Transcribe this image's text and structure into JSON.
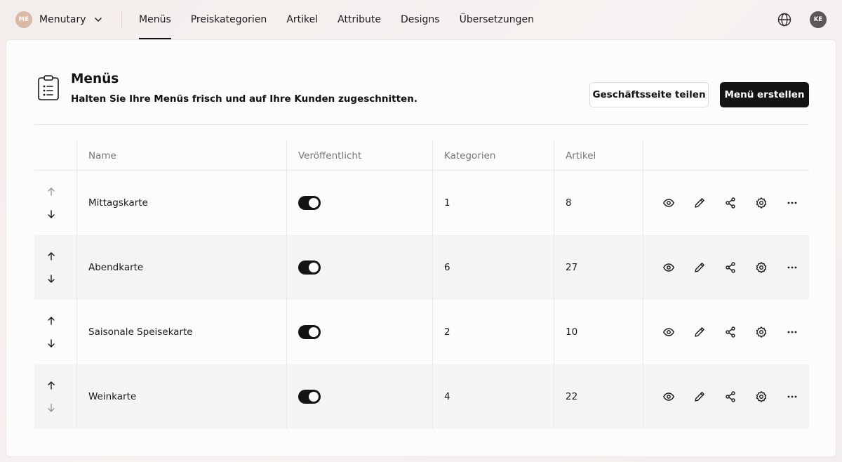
{
  "org": {
    "initials": "ME",
    "name": "Menutary"
  },
  "nav": {
    "items": [
      {
        "label": "Menüs",
        "active": true
      },
      {
        "label": "Preiskategorien",
        "active": false
      },
      {
        "label": "Artikel",
        "active": false
      },
      {
        "label": "Attribute",
        "active": false
      },
      {
        "label": "Designs",
        "active": false
      },
      {
        "label": "Übersetzungen",
        "active": false
      }
    ]
  },
  "user": {
    "initials": "KE"
  },
  "page": {
    "title": "Menüs",
    "subtitle": "Halten Sie Ihre Menüs frisch und auf Ihre Kunden zugeschnitten.",
    "share_label": "Geschäftsseite teilen",
    "create_label": "Menü erstellen"
  },
  "table": {
    "columns": [
      "Name",
      "Veröffentlicht",
      "Kategorien",
      "Artikel"
    ],
    "rows": [
      {
        "name": "Mittagskarte",
        "published": true,
        "categories": "1",
        "articles": "8",
        "can_move_up": false,
        "can_move_down": true
      },
      {
        "name": "Abendkarte",
        "published": true,
        "categories": "6",
        "articles": "27",
        "can_move_up": true,
        "can_move_down": true
      },
      {
        "name": "Saisonale Speisekarte",
        "published": true,
        "categories": "2",
        "articles": "10",
        "can_move_up": true,
        "can_move_down": true
      },
      {
        "name": "Weinkarte",
        "published": true,
        "categories": "4",
        "articles": "22",
        "can_move_up": true,
        "can_move_down": false
      }
    ],
    "row_actions": [
      "eye-icon",
      "pencil-icon",
      "share-icon",
      "settings-icon",
      "more-icon"
    ]
  },
  "colors": {
    "accent": "#141414",
    "org_avatar": "#d9b8a5",
    "user_avatar": "#5b5757",
    "disabled_arrow": "#9a9594"
  }
}
